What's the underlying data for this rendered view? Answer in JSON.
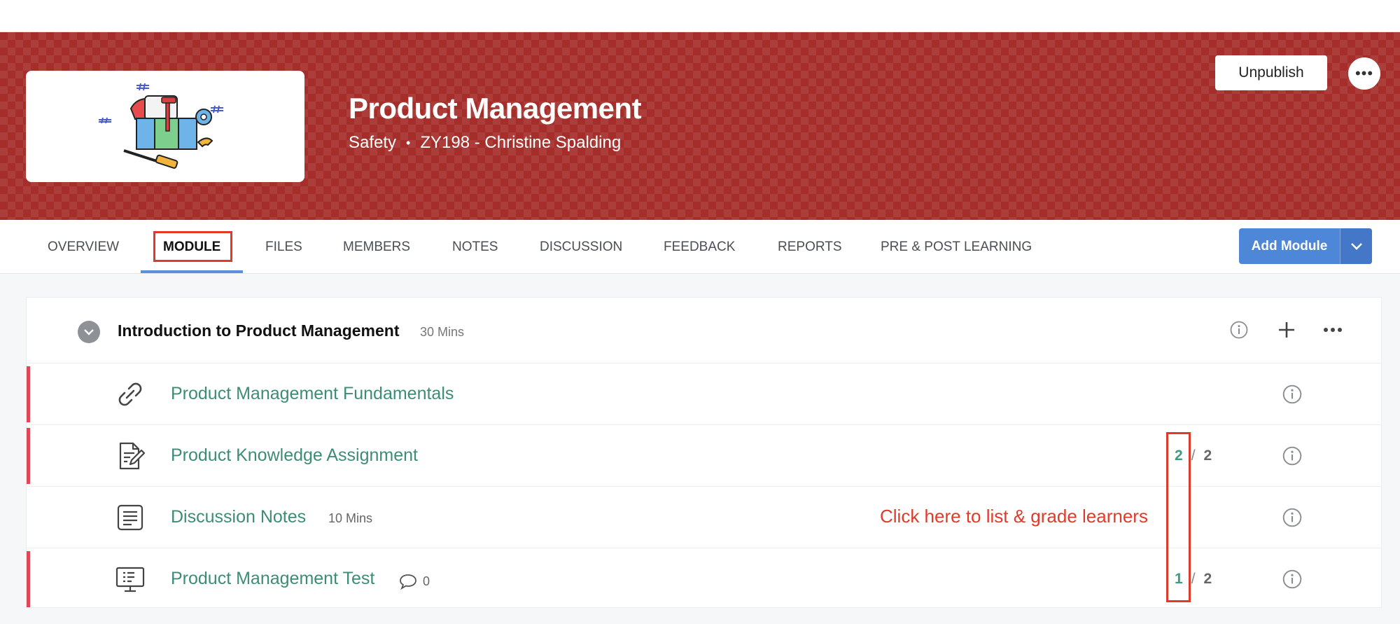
{
  "course": {
    "title": "Product Management",
    "category": "Safety",
    "separator": "•",
    "code_instructor": "ZY198 - Christine Spalding",
    "unpublish_label": "Unpublish",
    "more_label": "•••"
  },
  "tabs": [
    {
      "label": "OVERVIEW",
      "active": false
    },
    {
      "label": "MODULE",
      "active": true
    },
    {
      "label": "FILES",
      "active": false
    },
    {
      "label": "MEMBERS",
      "active": false
    },
    {
      "label": "NOTES",
      "active": false
    },
    {
      "label": "DISCUSSION",
      "active": false
    },
    {
      "label": "FEEDBACK",
      "active": false
    },
    {
      "label": "REPORTS",
      "active": false
    },
    {
      "label": "PRE & POST LEARNING",
      "active": false
    }
  ],
  "add_module_label": "Add Module",
  "module": {
    "title": "Introduction to Product Management",
    "duration": "30 Mins",
    "items": [
      {
        "title": "Product Management Fundamentals",
        "icon": "link-icon"
      },
      {
        "title": "Product Knowledge Assignment",
        "icon": "assignment-icon",
        "score": "2",
        "total": "2"
      },
      {
        "title": "Discussion Notes",
        "icon": "notes-icon",
        "duration": "10 Mins"
      },
      {
        "title": "Product Management Test",
        "icon": "test-icon",
        "comments": "0",
        "score": "1",
        "total": "2"
      }
    ]
  },
  "score_separator": "/",
  "annotation": "Click here to list & grade learners",
  "colors": {
    "banner": "#a52e2b",
    "accent_blue": "#4e86d8",
    "link_green": "#3e8c78",
    "annotation_red": "#e03a2a",
    "row_accent": "#e0485a"
  }
}
